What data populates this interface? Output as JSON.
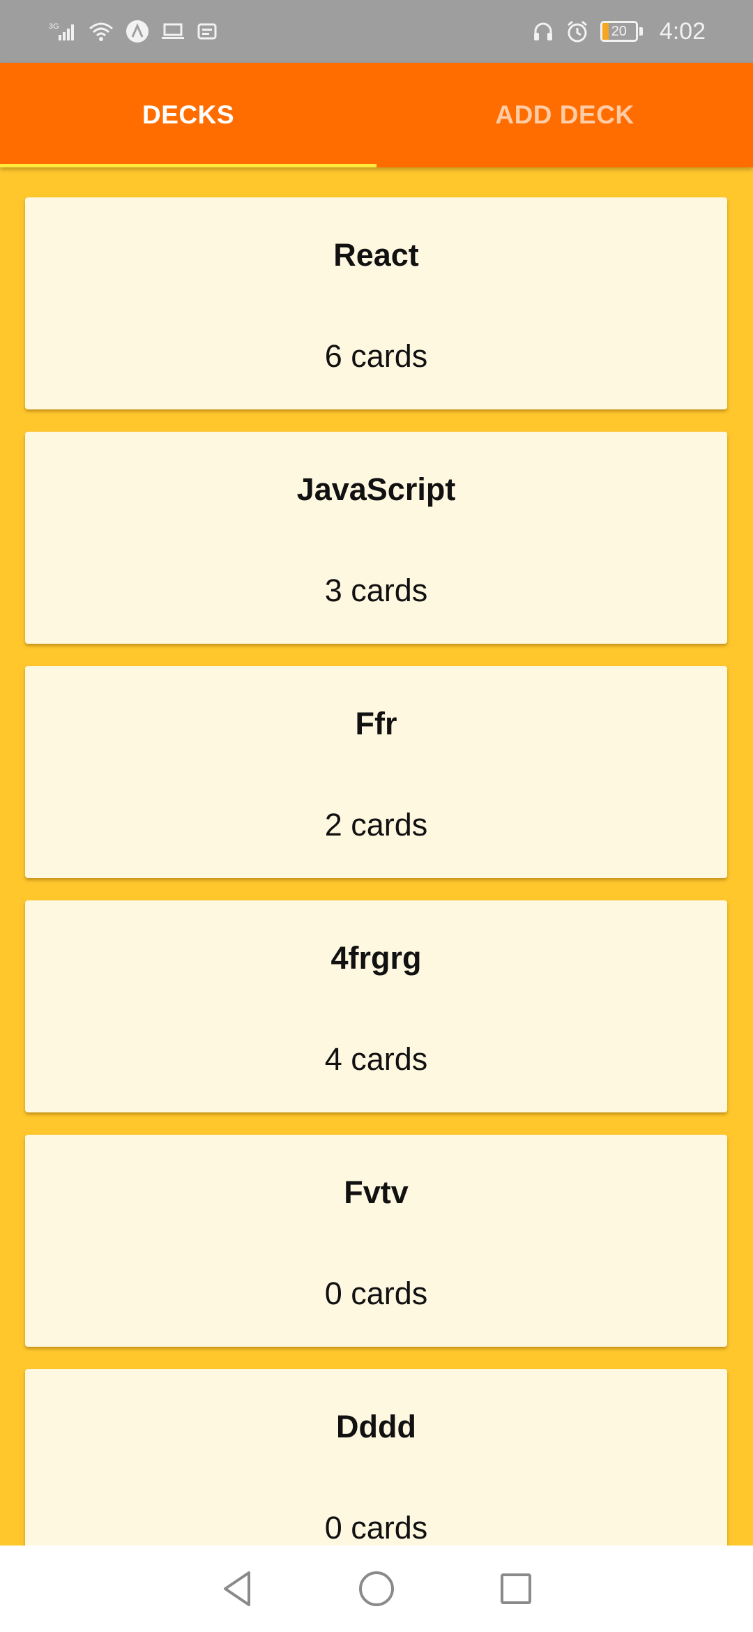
{
  "status_bar": {
    "network": "3G",
    "battery_level": "20",
    "time": "4:02",
    "icons_left": [
      "signal-icon",
      "wifi-icon",
      "app-icon",
      "laptop-icon",
      "notification-icon"
    ],
    "icons_right": [
      "headphones-icon",
      "alarm-icon",
      "battery-icon"
    ]
  },
  "tabs": [
    {
      "label": "DECKS",
      "active": true
    },
    {
      "label": "ADD DECK",
      "active": false
    }
  ],
  "decks": [
    {
      "title": "React",
      "count": "6 cards"
    },
    {
      "title": "JavaScript",
      "count": "3 cards"
    },
    {
      "title": "Ffr",
      "count": "2 cards"
    },
    {
      "title": "4frgrg",
      "count": "4 cards"
    },
    {
      "title": "Fvtv",
      "count": "0 cards"
    },
    {
      "title": "Dddd",
      "count": "0 cards"
    }
  ],
  "nav": [
    "back-icon",
    "home-icon",
    "recents-icon"
  ],
  "colors": {
    "header": "#FF6D00",
    "background": "#FFC72C",
    "card": "#FFF8E1",
    "indicator": "#FFEB3B",
    "status_bar": "#9E9E9E"
  }
}
